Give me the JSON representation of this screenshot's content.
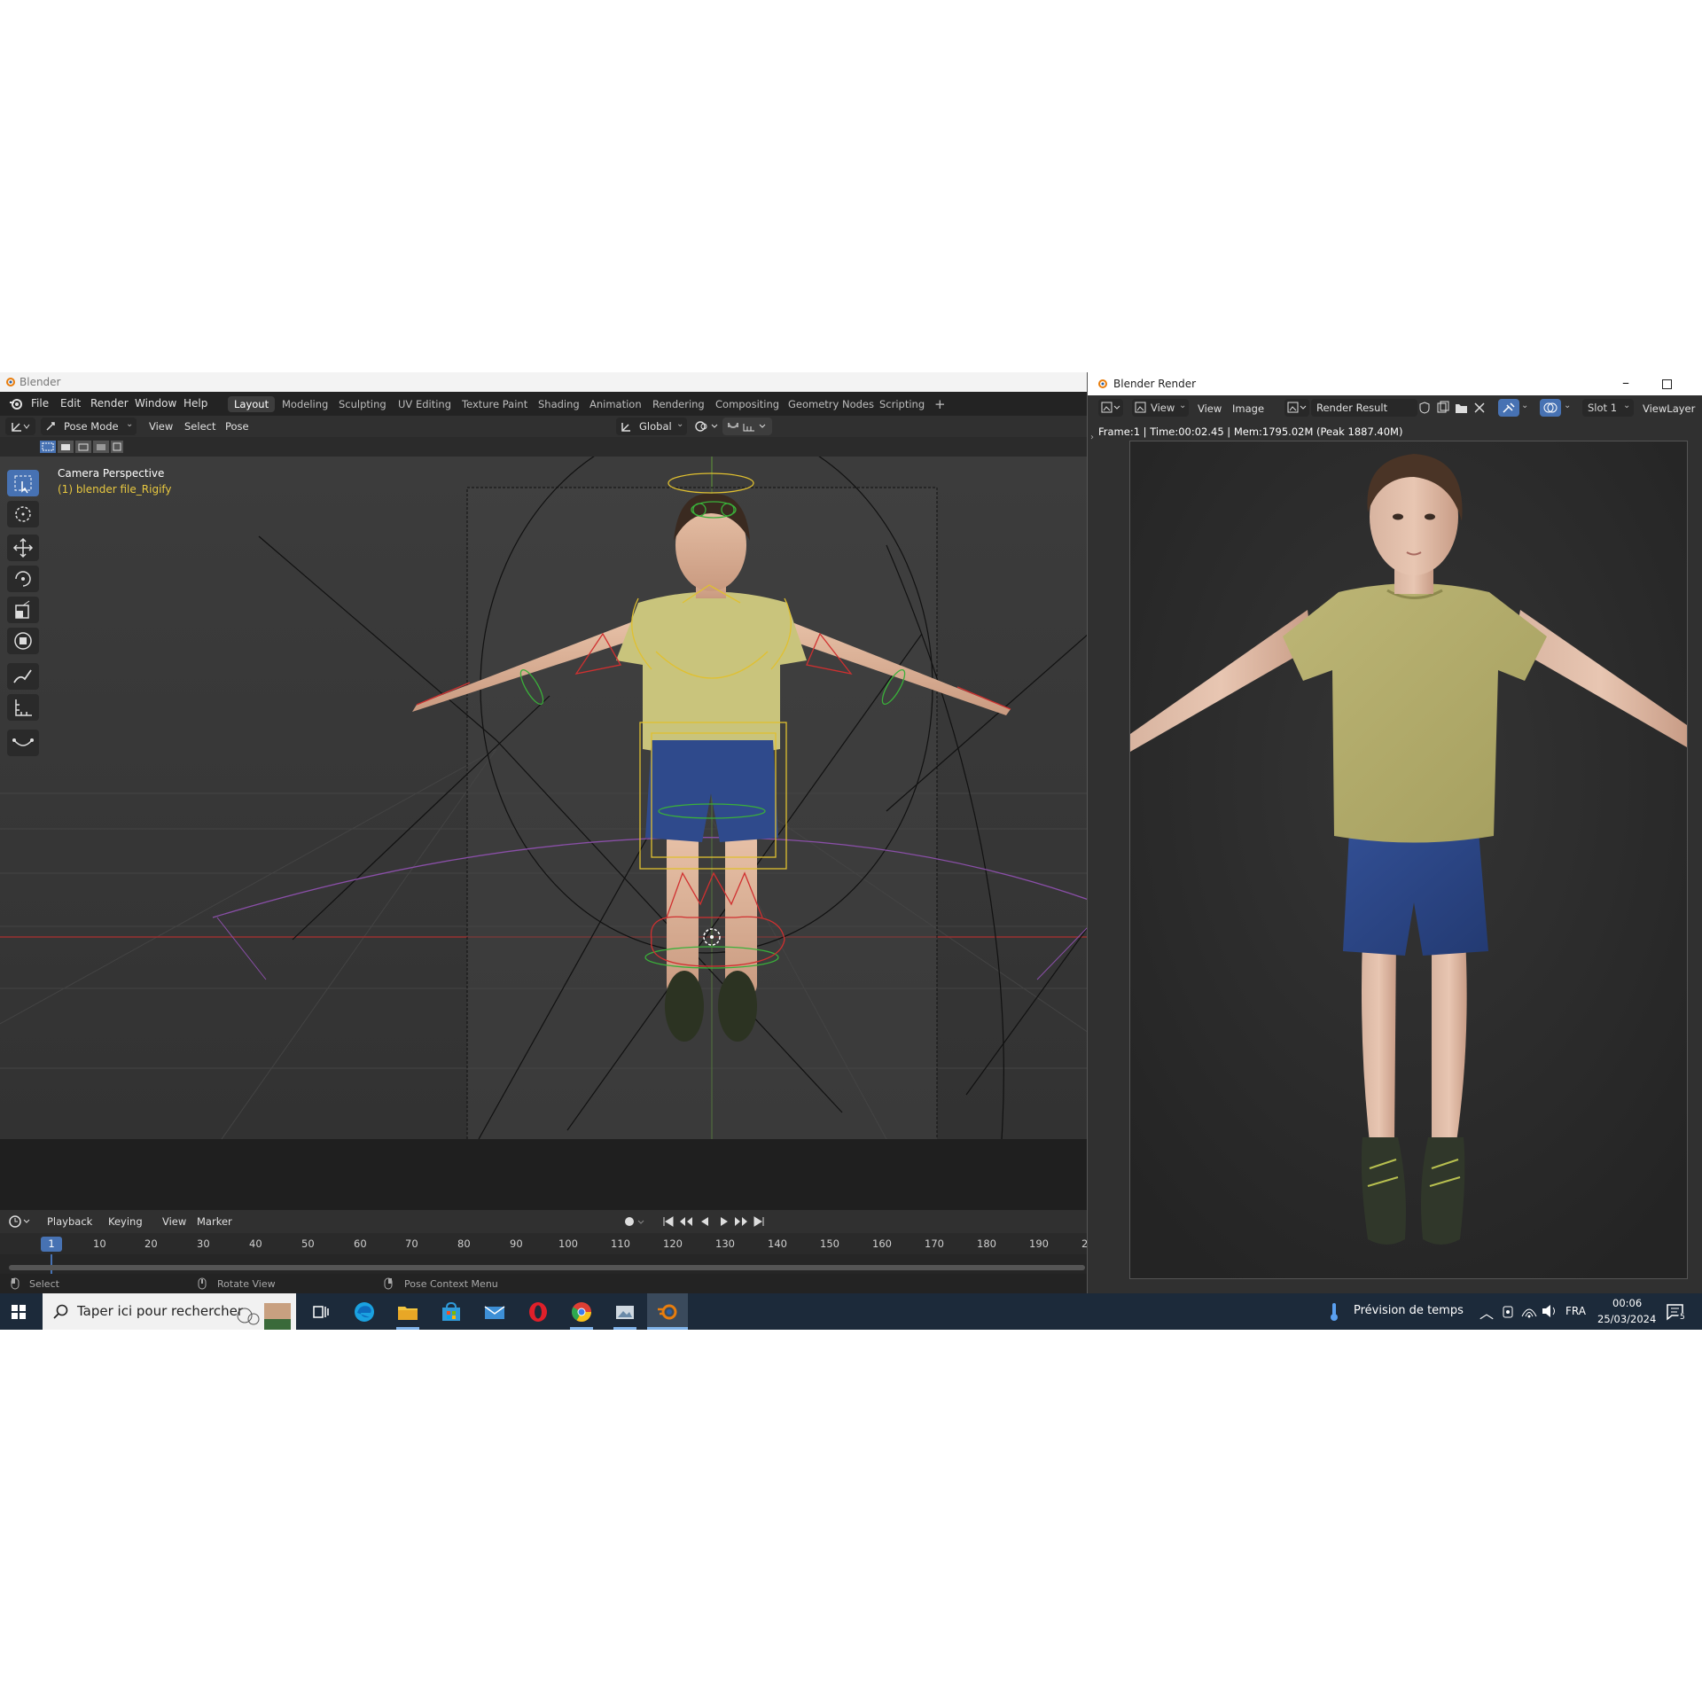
{
  "main_window": {
    "title": "Blender",
    "menus": [
      "File",
      "Edit",
      "Render",
      "Window",
      "Help"
    ],
    "workspaces": [
      "Layout",
      "Modeling",
      "Sculpting",
      "UV Editing",
      "Texture Paint",
      "Shading",
      "Animation",
      "Rendering",
      "Compositing",
      "Geometry Nodes",
      "Scripting"
    ],
    "add_workspace": "+",
    "header": {
      "mode": "Pose Mode",
      "menus": [
        "View",
        "Select",
        "Pose"
      ],
      "orientation": "Global"
    },
    "viewport": {
      "camera_label": "Camera Perspective",
      "object_label": "(1) blender file_Rigify"
    },
    "timeline": {
      "menus": [
        "Playback",
        "Keying",
        "View",
        "Marker"
      ],
      "current_frame": "1",
      "ticks": [
        "10",
        "20",
        "30",
        "40",
        "50",
        "60",
        "70",
        "80",
        "90",
        "100",
        "110",
        "120",
        "130",
        "140",
        "150",
        "160",
        "170",
        "180",
        "190",
        "2"
      ]
    },
    "status": {
      "left": "Select",
      "middle": "Rotate View",
      "right": "Pose Context Menu"
    }
  },
  "render_window": {
    "title": "Blender Render",
    "header": {
      "menus": [
        "View",
        "View",
        "Image"
      ],
      "image_name": "Render Result",
      "slot": "Slot 1",
      "view_layer": "ViewLayer"
    },
    "info": "Frame:1 | Time:00:02.45 | Mem:1795.02M (Peak 1887.40M)"
  },
  "taskbar": {
    "search_placeholder": "Taper ici pour rechercher",
    "weather": "Prévision de temps",
    "language": "FRA",
    "time": "00:06",
    "date": "25/03/2024",
    "notifications": "5"
  },
  "colors": {
    "accent": "#4772b3",
    "shirt": "#c9c47c",
    "shorts": "#2f4a8c",
    "taskbar": "#1c2a3a"
  }
}
